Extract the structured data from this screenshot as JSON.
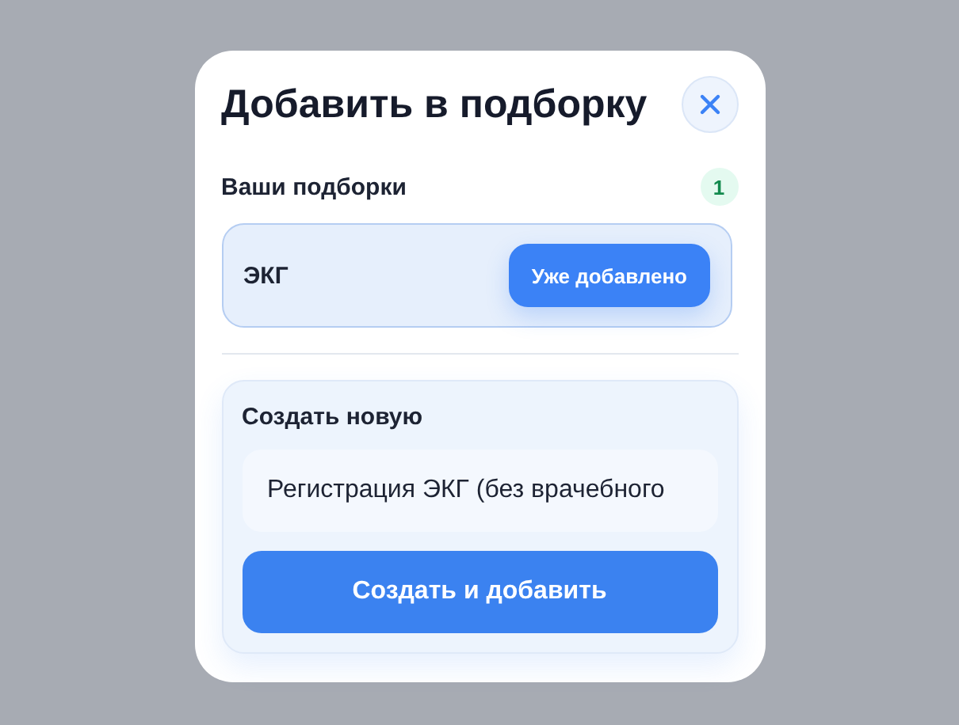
{
  "dialog": {
    "title": "Добавить в подборку",
    "collections_header": {
      "label": "Ваши подборки",
      "count": "1"
    },
    "collections": [
      {
        "name": "ЭКГ",
        "action": "Уже добавлено",
        "added": true
      }
    ],
    "create": {
      "label": "Создать новую",
      "input_value": "Регистрация ЭКГ (без врачебного",
      "button": "Создать и добавить"
    }
  }
}
